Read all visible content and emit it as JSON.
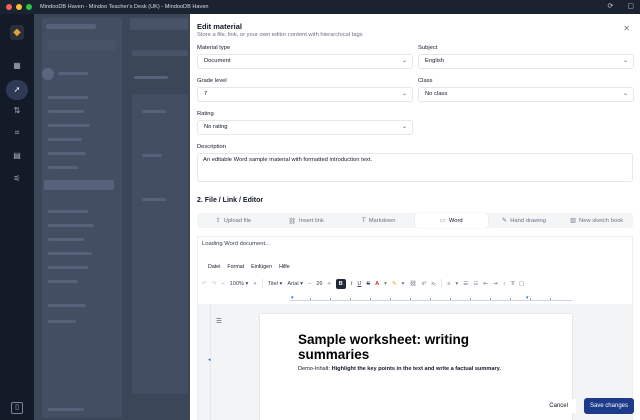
{
  "window": {
    "title": "MindooDB Haven - Mindoo Teacher's Desk (UK) - MindooDB Haven"
  },
  "rail": {
    "icons": [
      "app-logo-icon",
      "dashboard-icon",
      "rocket-icon",
      "sort-arrows-icon",
      "scan-icon",
      "calendar-icon",
      "sliders-icon",
      "sidebar-toggle-icon"
    ]
  },
  "dialog": {
    "title": "Edit material",
    "subtitle": "Store a file, link, or your own editor content with hierarchical tags",
    "material_type": {
      "label": "Material type",
      "value": "Document"
    },
    "subject": {
      "label": "Subject",
      "value": "English"
    },
    "grade_level": {
      "label": "Grade level",
      "value": "7"
    },
    "class": {
      "label": "Class",
      "value": "No class"
    },
    "rating": {
      "label": "Rating",
      "value": "No rating"
    },
    "description": {
      "label": "Description",
      "value": "An editable Word sample material with formatted introduction text."
    },
    "section_title": "2. File / Link / Editor",
    "tabs": [
      {
        "label": "Upload file",
        "icon": "upload-icon"
      },
      {
        "label": "Insert link",
        "icon": "link-icon"
      },
      {
        "label": "Markdown",
        "icon": "text-icon"
      },
      {
        "label": "Word",
        "icon": "document-icon",
        "active": true
      },
      {
        "label": "Hand drawing",
        "icon": "pen-icon"
      },
      {
        "label": "New sketch book",
        "icon": "book-icon"
      }
    ],
    "editor": {
      "loading_text": "Loading Word document...",
      "menu": [
        "Datei",
        "Format",
        "Einfügen",
        "Hilfe"
      ],
      "zoom": "100%",
      "style": "Titel",
      "font": "Arial",
      "font_size": "26",
      "doc_title": "Sample worksheet: writing summaries",
      "doc_body_prefix": "Demo-Inhalt: ",
      "doc_body_bold": "Highlight the key points in the text and write a factual summary."
    },
    "cancel_label": "Cancel",
    "save_label": "Save changes"
  }
}
